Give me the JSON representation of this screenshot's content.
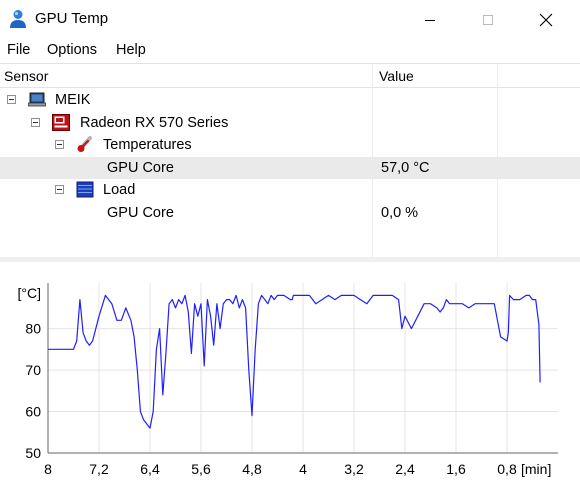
{
  "window": {
    "title": "GPU Temp",
    "app_icon": "person-icon",
    "controls": [
      "minimize-icon",
      "maximize-icon",
      "close-icon"
    ]
  },
  "menu": {
    "items": [
      "File",
      "Options",
      "Help"
    ]
  },
  "table": {
    "headers": {
      "sensor": "Sensor",
      "value": "Value"
    },
    "rows": [
      {
        "name": "MEIK",
        "value": "",
        "icon": "computer-icon"
      },
      {
        "name": "Radeon RX 570 Series",
        "value": "",
        "icon": "ati-gpu-icon"
      },
      {
        "name": "Temperatures",
        "value": "",
        "icon": "thermometer-icon"
      },
      {
        "name": "GPU Core",
        "value": "57,0 °C"
      },
      {
        "name": "Load",
        "value": "",
        "icon": "load-bars-icon"
      },
      {
        "name": "GPU Core",
        "value": "0,0 %"
      }
    ]
  },
  "chart_data": {
    "type": "line",
    "ylabel": "[°C]",
    "xlabel_unit": "[min]",
    "y_ticks": [
      "50",
      "60",
      "70",
      "80"
    ],
    "x_ticks": [
      "8",
      "7,2",
      "6,4",
      "5,6",
      "4,8",
      "4",
      "3,2",
      "2,4",
      "1,6",
      "0,8"
    ],
    "ylim": [
      50,
      91
    ],
    "xlim": [
      8,
      0
    ],
    "grid": true,
    "line_color": "#2020ff",
    "series": [
      {
        "x": [
          8.0,
          7.8,
          7.6,
          7.55,
          7.5,
          7.45,
          7.4,
          7.35,
          7.3,
          7.2,
          7.1,
          7.0,
          6.92,
          6.85,
          6.78,
          6.7,
          6.65,
          6.6,
          6.55,
          6.5,
          6.45,
          6.4,
          6.35,
          6.3,
          6.25,
          6.2,
          6.15,
          6.1,
          6.05,
          6.0,
          5.95,
          5.9,
          5.85,
          5.8,
          5.75,
          5.7,
          5.65,
          5.6,
          5.55,
          5.5,
          5.45,
          5.4,
          5.35,
          5.3,
          5.25,
          5.2,
          5.15,
          5.1,
          5.05,
          5.0,
          4.95,
          4.9,
          4.85,
          4.8,
          4.75,
          4.7,
          4.65,
          4.6,
          4.55,
          4.5,
          4.45,
          4.4,
          4.3,
          4.2,
          4.17,
          4.15,
          4.1,
          4.05,
          4.0,
          3.9,
          3.8,
          3.7,
          3.6,
          3.5,
          3.4,
          3.3,
          3.2,
          3.1,
          3.0,
          2.9,
          2.8,
          2.7,
          2.6,
          2.5,
          2.45,
          2.4,
          2.3,
          2.2,
          2.1,
          2.0,
          1.9,
          1.85,
          1.8,
          1.75,
          1.7,
          1.65,
          1.6,
          1.5,
          1.4,
          1.3,
          1.2,
          1.1,
          1.0,
          0.9,
          0.8,
          0.78,
          0.76,
          0.7,
          0.6,
          0.5,
          0.45,
          0.4,
          0.35,
          0.3,
          0.28
        ],
        "y": [
          75,
          75,
          75,
          77,
          87,
          79,
          77,
          76,
          77,
          83,
          88,
          86,
          82,
          82,
          85,
          82,
          78,
          70,
          60,
          58,
          57,
          56,
          60,
          75,
          80,
          64,
          74,
          86,
          87,
          85,
          87,
          86,
          88,
          84,
          74,
          86,
          83,
          86,
          71,
          87,
          83,
          76,
          86,
          80,
          86,
          87,
          87,
          86,
          88,
          85,
          87,
          85,
          70,
          59,
          75,
          86,
          88,
          87,
          86,
          88,
          87,
          88,
          88,
          87,
          87,
          88,
          88,
          88,
          88,
          88,
          86,
          87,
          88,
          87,
          88,
          88,
          88,
          87,
          86,
          88,
          88,
          88,
          88,
          87,
          80,
          83,
          80,
          83,
          86,
          86,
          85,
          84,
          85,
          87,
          86,
          86,
          86,
          86,
          85,
          86,
          86,
          86,
          86,
          78,
          77,
          79,
          88,
          87,
          87,
          88,
          88,
          87,
          87,
          81,
          67
        ]
      }
    ]
  }
}
